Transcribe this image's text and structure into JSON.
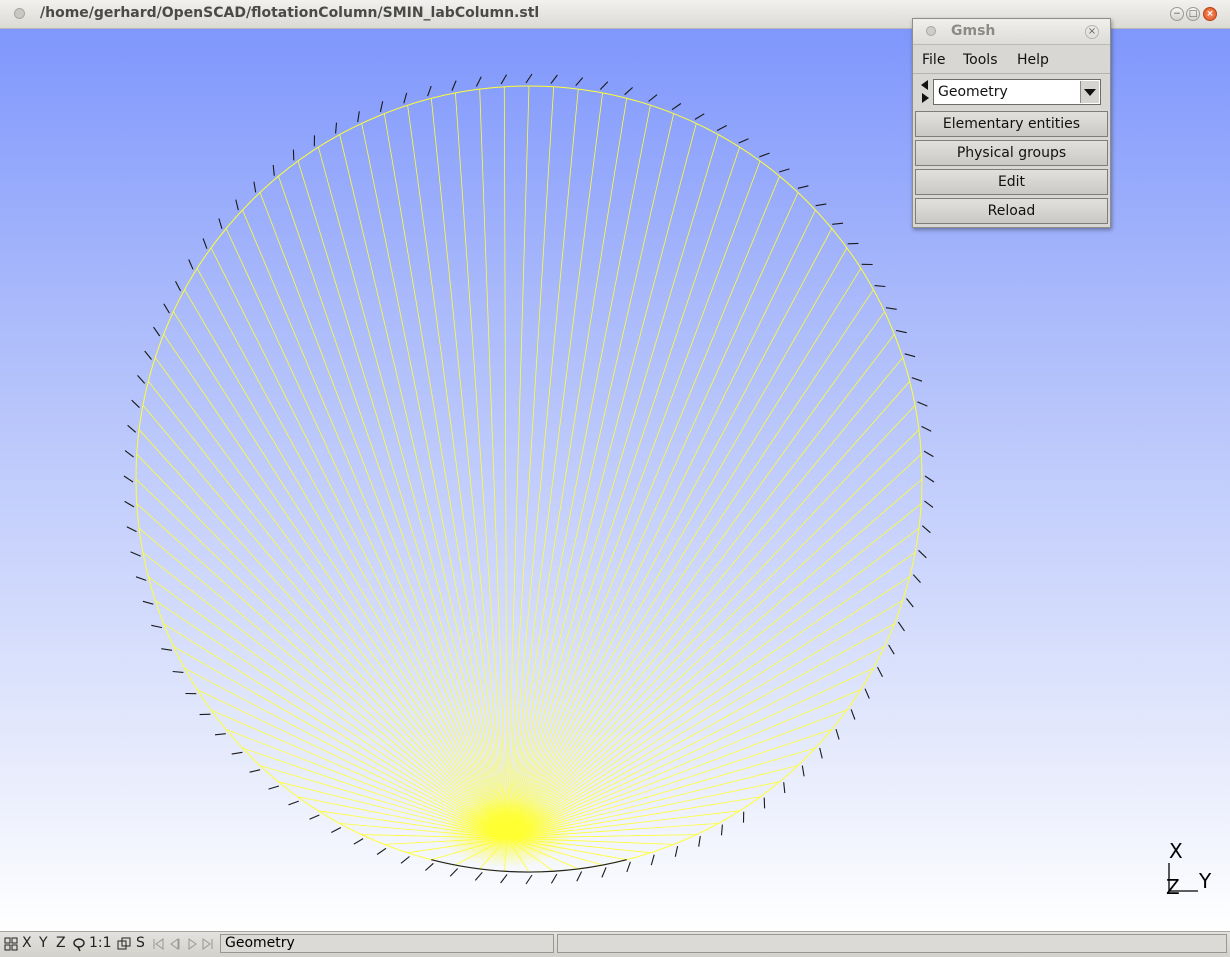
{
  "window": {
    "title": "/home/gerhard/OpenSCAD/flotationColumn/SMIN_labColumn.stl",
    "close_glyph": "×",
    "min_glyph": "−",
    "max_glyph": "□"
  },
  "gmsh_panel": {
    "title": "Gmsh",
    "close_glyph": "×",
    "menu": [
      "File",
      "Tools",
      "Help"
    ],
    "module": "Geometry",
    "buttons": [
      "Elementary entities",
      "Physical groups",
      "Edit",
      "Reload"
    ]
  },
  "axes": {
    "x": "X",
    "y": "Y",
    "z": "Z"
  },
  "statusbar": {
    "x": "X",
    "y": "Y",
    "z": "Z",
    "scale": "1:1",
    "s": "S",
    "message": "Geometry",
    "icons": [
      "grid-icon",
      "rotate-icon",
      "cube-icon",
      "first-icon",
      "prev-icon",
      "play-icon",
      "last-icon"
    ]
  },
  "colors": {
    "bg_top": "#7f97fc",
    "bg_bottom": "#ffffff",
    "lines": "#ffff33",
    "normals": "#1a1a1a"
  }
}
